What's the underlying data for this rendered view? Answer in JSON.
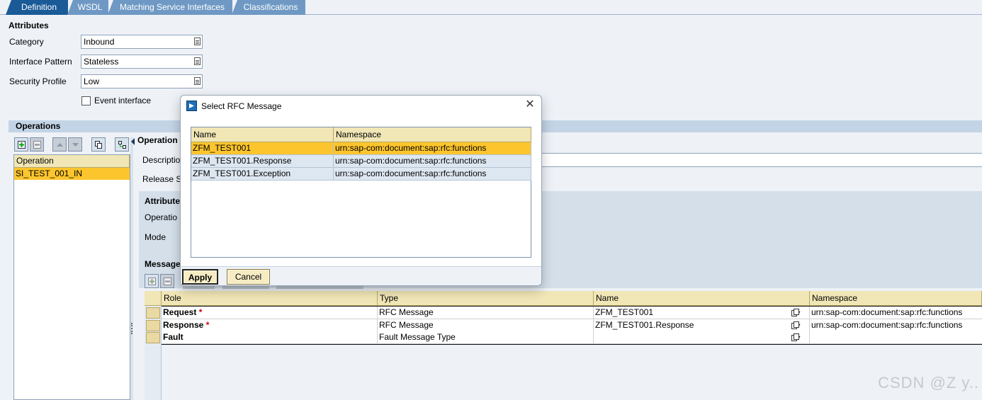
{
  "tabs": [
    {
      "label": "Definition",
      "active": true
    },
    {
      "label": "WSDL",
      "active": false
    },
    {
      "label": "Matching Service Interfaces",
      "active": false
    },
    {
      "label": "Classifications",
      "active": false
    }
  ],
  "attributes": {
    "title": "Attributes",
    "category_label": "Category",
    "category_value": "Inbound",
    "pattern_label": "Interface Pattern",
    "pattern_value": "Stateless",
    "security_label": "Security Profile",
    "security_value": "Low",
    "event_label": "Event interface"
  },
  "operations": {
    "title": "Operations",
    "column": "Operation",
    "selected": "SI_TEST_001_IN",
    "detail_header": "Operation",
    "description_label": "Descriptio",
    "release_label": "Release S",
    "attr_title": "Attribute",
    "operation_label": "Operatio",
    "mode_label": "Mode",
    "messages_title": "Message"
  },
  "message_grid": {
    "columns": [
      "Role",
      "Type",
      "Name",
      "Namespace"
    ],
    "rows": [
      {
        "role": "Request",
        "required": "*",
        "type": "RFC Message",
        "name": "ZFM_TEST001",
        "namespace": "urn:sap-com:document:sap:rfc:functions"
      },
      {
        "role": "Response",
        "required": "*",
        "type": "RFC Message",
        "name": "ZFM_TEST001.Response",
        "namespace": "urn:sap-com:document:sap:rfc:functions"
      },
      {
        "role": "Fault",
        "required": "",
        "type": "Fault Message Type",
        "name": "",
        "namespace": ""
      }
    ]
  },
  "dialog": {
    "title": "Select RFC Message",
    "columns": [
      "Name",
      "Namespace"
    ],
    "rows": [
      {
        "name": "ZFM_TEST001",
        "namespace": "urn:sap-com:document:sap:rfc:functions"
      },
      {
        "name": "ZFM_TEST001.Response",
        "namespace": "urn:sap-com:document:sap:rfc:functions"
      },
      {
        "name": "ZFM_TEST001.Exception",
        "namespace": "urn:sap-com:document:sap:rfc:functions"
      }
    ],
    "apply_label": "Apply",
    "cancel_label": "Cancel"
  },
  "watermark": "CSDN @Z y..",
  "colors": {
    "active_tab": "#1a5a97",
    "tab": "#6f99c4",
    "selection": "#fcc52d",
    "header": "#f0e6b6"
  }
}
